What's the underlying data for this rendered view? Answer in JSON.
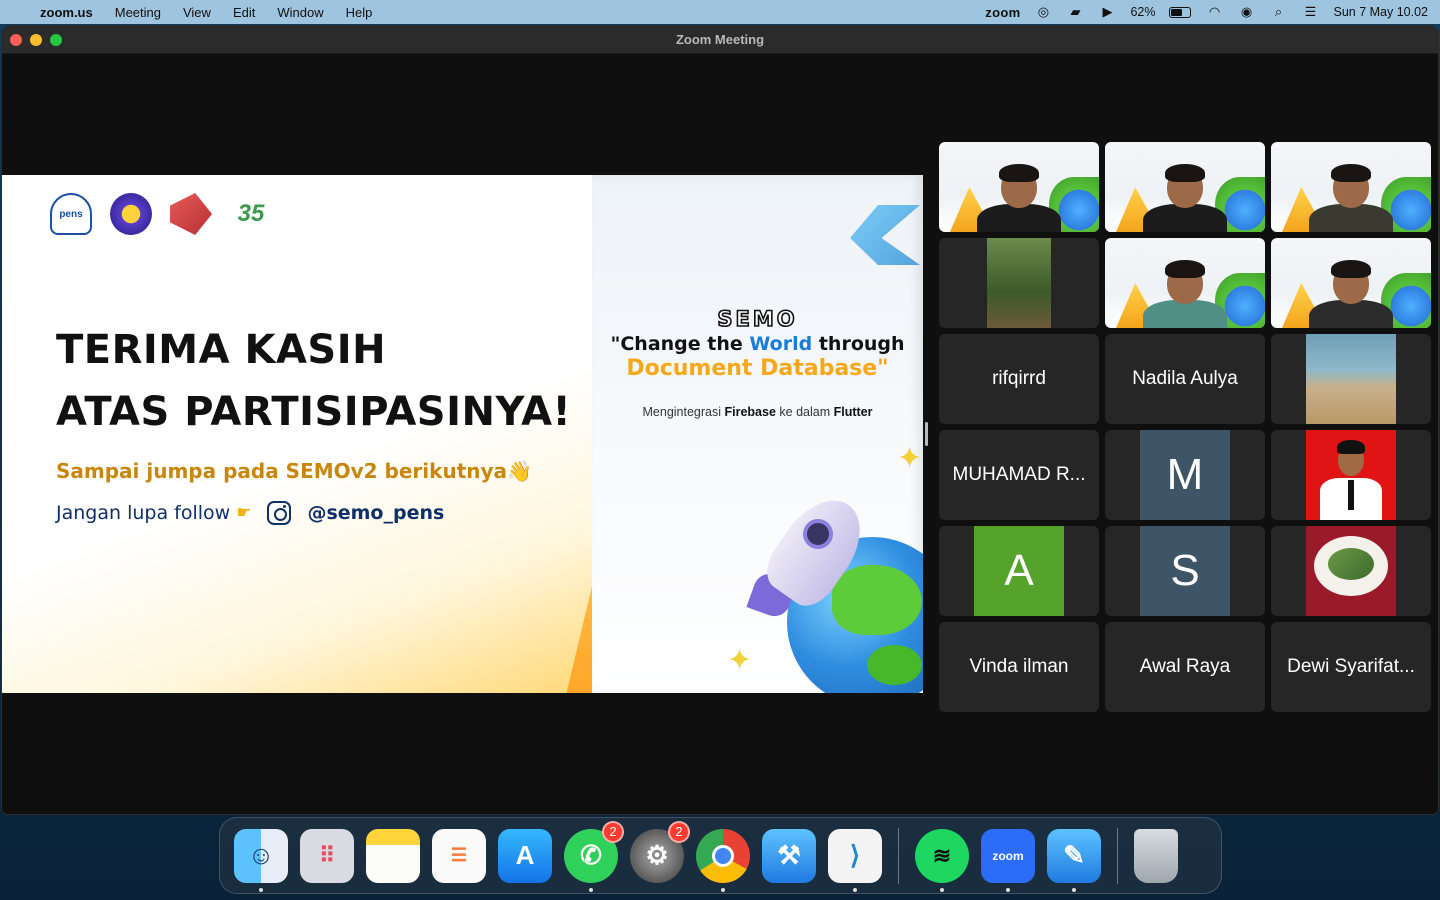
{
  "menubar": {
    "apple": "",
    "app_name": "zoom.us",
    "menus": [
      "Meeting",
      "View",
      "Edit",
      "Window",
      "Help"
    ],
    "zoom_status": "zoom",
    "battery": "62%",
    "battery_level": 0.62,
    "datetime": "Sun 7 May  10.02"
  },
  "window": {
    "title": "Zoom Meeting"
  },
  "slide": {
    "thanks_line1": "TERIMA KASIH",
    "thanks_line2": "ATAS PARTISIPASINYA!",
    "sampai": "Sampai jumpa pada SEMOv2 berikutnya👋",
    "follow": "Jangan lupa follow",
    "handle": "@semo_pens",
    "logo_pens": "pens",
    "logo_35": "35",
    "semo": "SEMO",
    "headline_pre": "\"Change the ",
    "headline_world": "World",
    "headline_post": " through",
    "docdb": "Document Database\"",
    "integr_pre": "Mengintegrasi ",
    "integr_firebase": "Firebase",
    "integr_mid": " ke dalam ",
    "integr_flutter": "Flutter"
  },
  "gallery": {
    "name_tiles": [
      "rifqirrd",
      "Nadila Aulya",
      "MUHAMAD R...",
      "Vinda ilman",
      "Awal Raya",
      "Dewi Syarifat..."
    ],
    "letters": [
      "M",
      "A",
      "S"
    ],
    "colors": {
      "M": "#3d5566",
      "A": "#56a32c",
      "S": "#3d5566",
      "active": "#2fd45a"
    }
  },
  "dock": {
    "apps": [
      "finder",
      "launchpad",
      "notes",
      "reminders",
      "app-store",
      "whatsapp",
      "system-settings",
      "chrome",
      "xcode",
      "vscode",
      "spotify",
      "zoom",
      "developer-tool",
      "trash"
    ],
    "whatsapp_badge": "2",
    "settings_badge": "2",
    "zoom_label": "zoom"
  }
}
